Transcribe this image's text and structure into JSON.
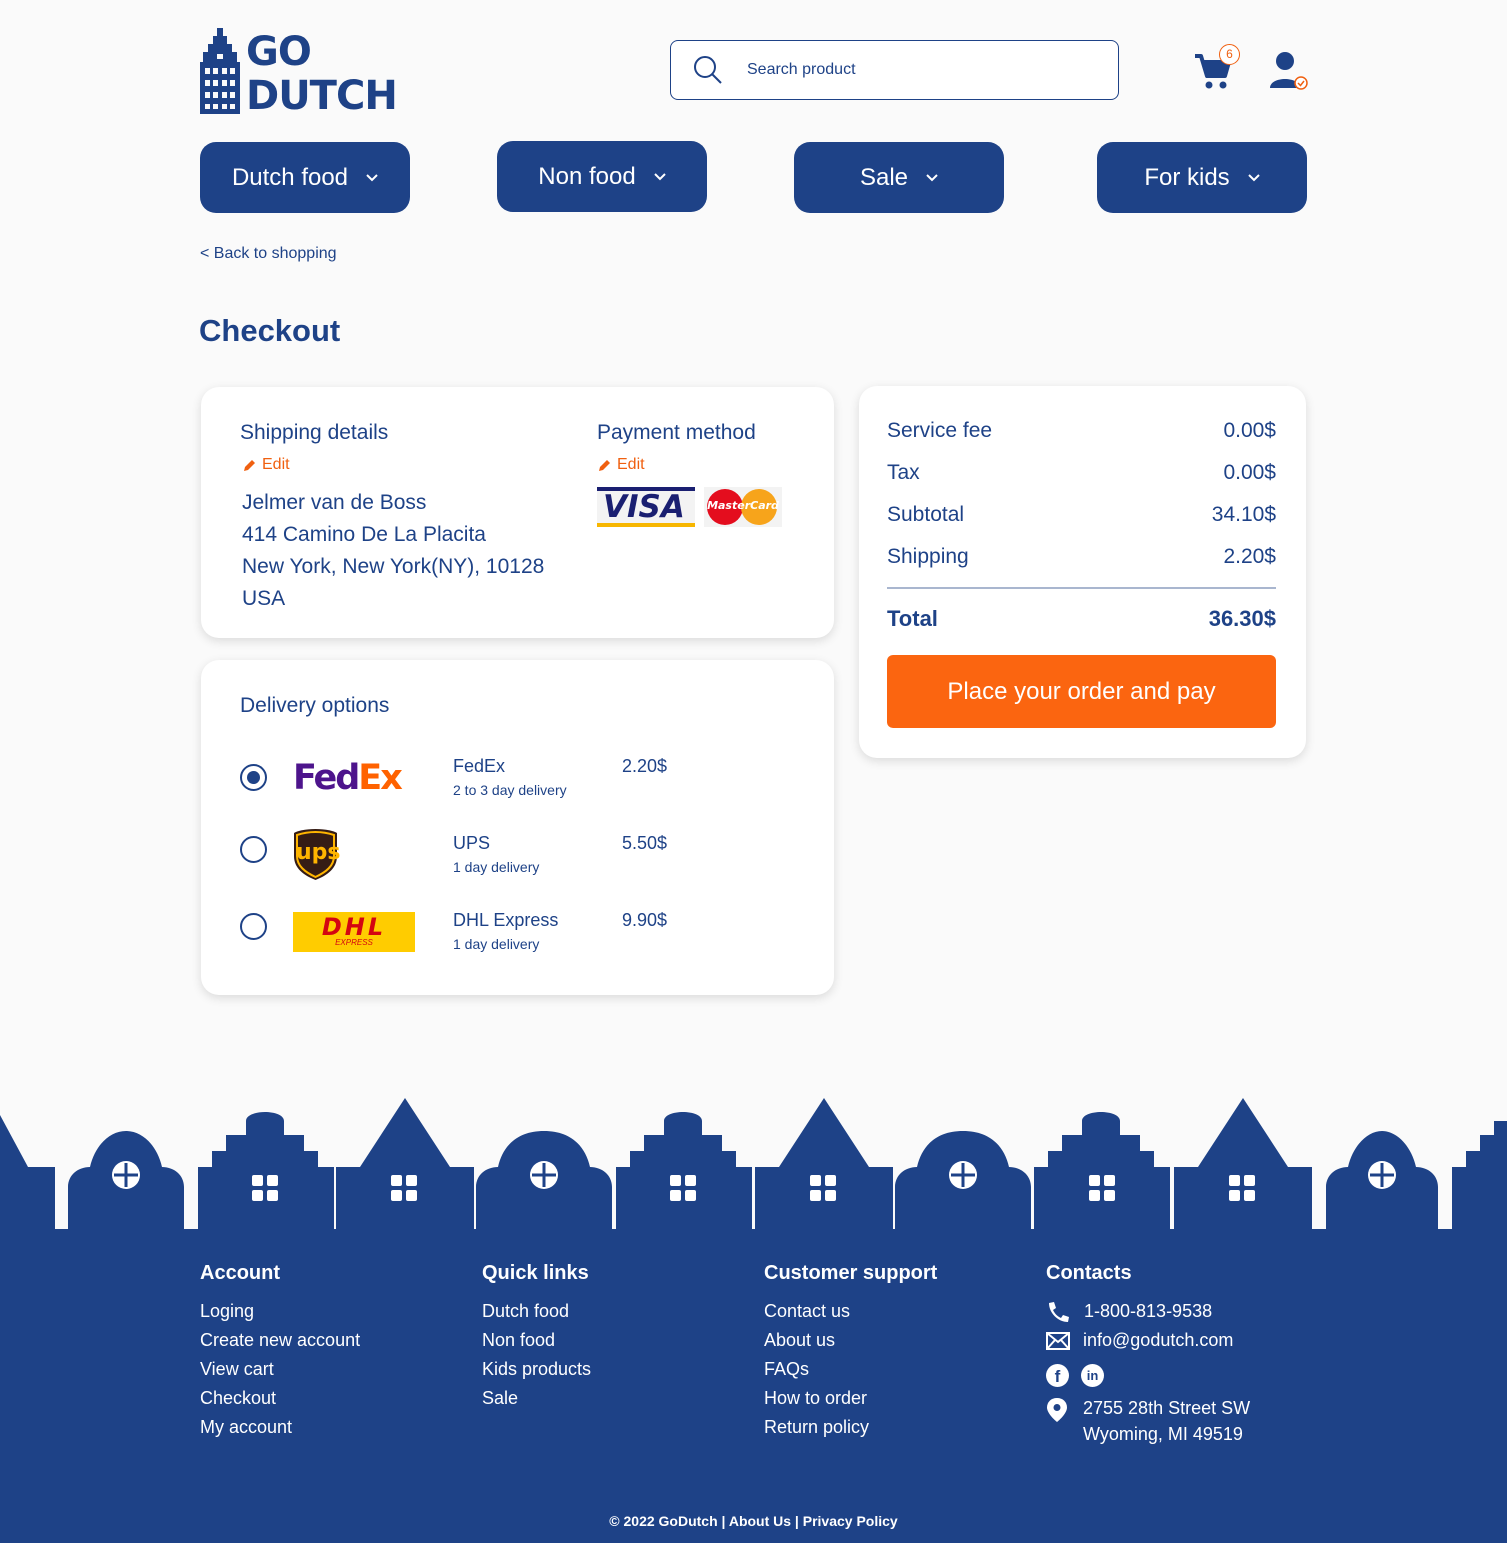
{
  "brand": {
    "line1": "GO",
    "line2": "DUTCH"
  },
  "search": {
    "placeholder": "Search product"
  },
  "cart": {
    "count": "6"
  },
  "nav": [
    {
      "label": "Dutch food"
    },
    {
      "label": "Non food"
    },
    {
      "label": "Sale"
    },
    {
      "label": "For kids"
    }
  ],
  "back_link": "< Back to shopping",
  "page_title": "Checkout",
  "shipping": {
    "title": "Shipping details",
    "edit": "Edit",
    "name": "Jelmer van de Boss",
    "street": "414 Camino De La Placita",
    "city": "New York, New York(NY), 10128",
    "country": "USA"
  },
  "payment": {
    "title": "Payment method",
    "edit": "Edit",
    "visa": "VISA",
    "mastercard": "MasterCard"
  },
  "summary": {
    "rows": [
      {
        "label": "Service fee",
        "value": "0.00$"
      },
      {
        "label": "Tax",
        "value": "0.00$"
      },
      {
        "label": "Subtotal",
        "value": "34.10$"
      },
      {
        "label": "Shipping",
        "value": "2.20$"
      }
    ],
    "total_label": "Total",
    "total_value": "36.30$",
    "pay_button": "Place your order and pay"
  },
  "delivery": {
    "title": "Delivery options",
    "options": [
      {
        "name": "FedEx",
        "sub": "2 to 3 day delivery",
        "price": "2.20$",
        "selected": true,
        "logo_icon": "fedex-logo",
        "logo_text_a": "Fed",
        "logo_text_b": "Ex"
      },
      {
        "name": "UPS",
        "sub": "1 day delivery",
        "price": "5.50$",
        "selected": false,
        "logo_icon": "ups-logo",
        "logo_text": "ups"
      },
      {
        "name": "DHL Express",
        "sub": "1 day delivery",
        "price": "9.90$",
        "selected": false,
        "logo_icon": "dhl-logo",
        "logo_text": "DHL",
        "logo_sub": "EXPRESS"
      }
    ]
  },
  "footer": {
    "account": {
      "title": "Account",
      "links": [
        "Loging",
        "Create new account",
        "View cart",
        "Checkout",
        "My account"
      ]
    },
    "quick": {
      "title": "Quick links",
      "links": [
        "Dutch food",
        "Non food",
        "Kids products",
        "Sale"
      ]
    },
    "support": {
      "title": "Customer support",
      "links": [
        "Contact us",
        "About us",
        "FAQs",
        "How to order",
        "Return policy"
      ]
    },
    "contacts": {
      "title": "Contacts",
      "phone": "1-800-813-9538",
      "email": "info@godutch.com",
      "address1": "2755 28th Street SW",
      "address2": "Wyoming, MI 49519"
    },
    "copyright": "© 2022 GoDutch |",
    "about": "About Us |",
    "privacy": "Privacy Policy"
  },
  "colors": {
    "primary": "#1e4287",
    "accent": "#fb6510",
    "background": "#fafafa"
  }
}
